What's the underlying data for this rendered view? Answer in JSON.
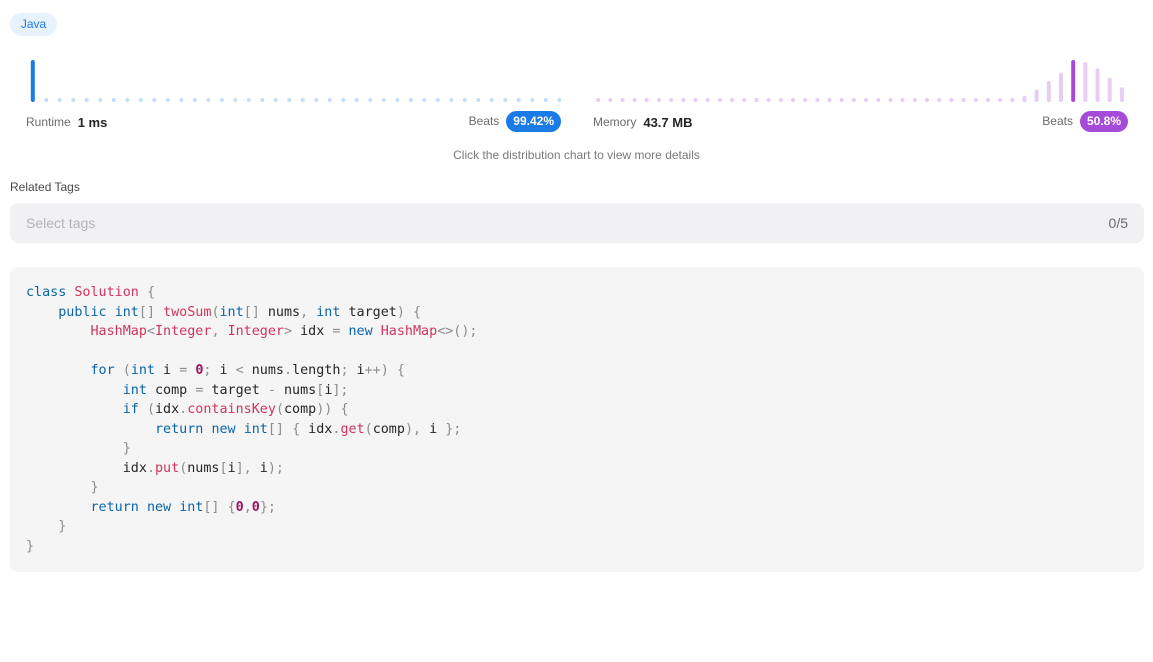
{
  "language": "Java",
  "runtime": {
    "label": "Runtime",
    "value": "1 ms",
    "beats_label": "Beats",
    "beats_value": "99.42%",
    "color": "#1a7be6",
    "light_color": "#c6def8"
  },
  "memory": {
    "label": "Memory",
    "value": "43.7 MB",
    "beats_label": "Beats",
    "beats_value": "50.8%",
    "color": "#a64ad9",
    "light_color": "#e5cdf5"
  },
  "chart_data": [
    {
      "type": "bar",
      "name": "runtime-distribution",
      "values": [
        100,
        5,
        3,
        3,
        3,
        3,
        3,
        3,
        3,
        3,
        3,
        3,
        3,
        3,
        3,
        3,
        3,
        3,
        8,
        3,
        3,
        8,
        3,
        3,
        3,
        3,
        3,
        3,
        3,
        3,
        3,
        3,
        3,
        3,
        3,
        3,
        3,
        3,
        3,
        3
      ],
      "highlight_index": 0,
      "ylim": [
        0,
        100
      ]
    },
    {
      "type": "bar",
      "name": "memory-distribution",
      "values": [
        3,
        3,
        3,
        3,
        3,
        3,
        3,
        3,
        3,
        3,
        3,
        3,
        3,
        3,
        3,
        3,
        3,
        3,
        3,
        3,
        3,
        3,
        3,
        3,
        3,
        3,
        3,
        3,
        3,
        3,
        3,
        3,
        3,
        3,
        3,
        15,
        30,
        50,
        70,
        100,
        95,
        80,
        58,
        35
      ],
      "highlight_index": 39,
      "ylim": [
        0,
        100
      ]
    }
  ],
  "hint": "Click the distribution chart to view more details",
  "related_tags": {
    "title": "Related Tags",
    "placeholder": "Select tags",
    "count": "0/5"
  },
  "code_lines": [
    [
      [
        "kw",
        "class"
      ],
      [
        "id",
        " "
      ],
      [
        "type",
        "Solution"
      ],
      [
        "id",
        " "
      ],
      [
        "punct",
        "{"
      ]
    ],
    [
      [
        "id",
        "    "
      ],
      [
        "kw",
        "public"
      ],
      [
        "id",
        " "
      ],
      [
        "kw",
        "int"
      ],
      [
        "punct",
        "[]"
      ],
      [
        "id",
        " "
      ],
      [
        "call",
        "twoSum"
      ],
      [
        "punct",
        "("
      ],
      [
        "kw",
        "int"
      ],
      [
        "punct",
        "[]"
      ],
      [
        "id",
        " nums"
      ],
      [
        "punct",
        ","
      ],
      [
        "id",
        " "
      ],
      [
        "kw",
        "int"
      ],
      [
        "id",
        " target"
      ],
      [
        "punct",
        ")"
      ],
      [
        "id",
        " "
      ],
      [
        "punct",
        "{"
      ]
    ],
    [
      [
        "id",
        "        "
      ],
      [
        "type",
        "HashMap"
      ],
      [
        "punct",
        "<"
      ],
      [
        "type",
        "Integer"
      ],
      [
        "punct",
        ","
      ],
      [
        "id",
        " "
      ],
      [
        "type",
        "Integer"
      ],
      [
        "punct",
        ">"
      ],
      [
        "id",
        " idx "
      ],
      [
        "punct",
        "="
      ],
      [
        "id",
        " "
      ],
      [
        "kw",
        "new"
      ],
      [
        "id",
        " "
      ],
      [
        "type",
        "HashMap"
      ],
      [
        "punct",
        "<>();"
      ]
    ],
    [
      [
        "id",
        ""
      ]
    ],
    [
      [
        "id",
        "        "
      ],
      [
        "kw",
        "for"
      ],
      [
        "id",
        " "
      ],
      [
        "punct",
        "("
      ],
      [
        "kw",
        "int"
      ],
      [
        "id",
        " i "
      ],
      [
        "punct",
        "="
      ],
      [
        "id",
        " "
      ],
      [
        "num",
        "0"
      ],
      [
        "punct",
        ";"
      ],
      [
        "id",
        " i "
      ],
      [
        "punct",
        "<"
      ],
      [
        "id",
        " nums"
      ],
      [
        "punct",
        "."
      ],
      [
        "id",
        "length"
      ],
      [
        "punct",
        ";"
      ],
      [
        "id",
        " i"
      ],
      [
        "punct",
        "++)"
      ],
      [
        "id",
        " "
      ],
      [
        "punct",
        "{"
      ]
    ],
    [
      [
        "id",
        "            "
      ],
      [
        "kw",
        "int"
      ],
      [
        "id",
        " comp "
      ],
      [
        "punct",
        "="
      ],
      [
        "id",
        " target "
      ],
      [
        "punct",
        "-"
      ],
      [
        "id",
        " nums"
      ],
      [
        "punct",
        "["
      ],
      [
        "id",
        "i"
      ],
      [
        "punct",
        "];"
      ]
    ],
    [
      [
        "id",
        "            "
      ],
      [
        "kw",
        "if"
      ],
      [
        "id",
        " "
      ],
      [
        "punct",
        "("
      ],
      [
        "id",
        "idx"
      ],
      [
        "punct",
        "."
      ],
      [
        "call",
        "containsKey"
      ],
      [
        "punct",
        "("
      ],
      [
        "id",
        "comp"
      ],
      [
        "punct",
        "))"
      ],
      [
        "id",
        " "
      ],
      [
        "punct",
        "{"
      ]
    ],
    [
      [
        "id",
        "                "
      ],
      [
        "kw",
        "return"
      ],
      [
        "id",
        " "
      ],
      [
        "kw",
        "new"
      ],
      [
        "id",
        " "
      ],
      [
        "kw",
        "int"
      ],
      [
        "punct",
        "[]"
      ],
      [
        "id",
        " "
      ],
      [
        "punct",
        "{"
      ],
      [
        "id",
        " idx"
      ],
      [
        "punct",
        "."
      ],
      [
        "call",
        "get"
      ],
      [
        "punct",
        "("
      ],
      [
        "id",
        "comp"
      ],
      [
        "punct",
        "),"
      ],
      [
        "id",
        " i "
      ],
      [
        "punct",
        "};"
      ]
    ],
    [
      [
        "id",
        "            "
      ],
      [
        "punct",
        "}"
      ]
    ],
    [
      [
        "id",
        "            idx"
      ],
      [
        "punct",
        "."
      ],
      [
        "call",
        "put"
      ],
      [
        "punct",
        "("
      ],
      [
        "id",
        "nums"
      ],
      [
        "punct",
        "["
      ],
      [
        "id",
        "i"
      ],
      [
        "punct",
        "],"
      ],
      [
        "id",
        " i"
      ],
      [
        "punct",
        ");"
      ]
    ],
    [
      [
        "id",
        "        "
      ],
      [
        "punct",
        "}"
      ]
    ],
    [
      [
        "id",
        "        "
      ],
      [
        "kw",
        "return"
      ],
      [
        "id",
        " "
      ],
      [
        "kw",
        "new"
      ],
      [
        "id",
        " "
      ],
      [
        "kw",
        "int"
      ],
      [
        "punct",
        "[]"
      ],
      [
        "id",
        " "
      ],
      [
        "punct",
        "{"
      ],
      [
        "num",
        "0"
      ],
      [
        "punct",
        ","
      ],
      [
        "num",
        "0"
      ],
      [
        "punct",
        "};"
      ]
    ],
    [
      [
        "id",
        "    "
      ],
      [
        "punct",
        "}"
      ]
    ],
    [
      [
        "punct",
        "}"
      ]
    ]
  ]
}
